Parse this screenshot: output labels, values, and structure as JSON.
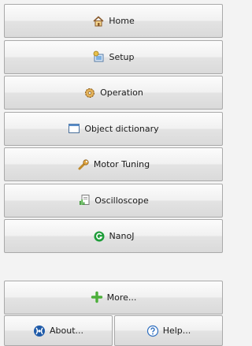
{
  "nav": {
    "home": {
      "label": "Home",
      "icon": "house-icon"
    },
    "setup": {
      "label": "Setup",
      "icon": "setup-wizard-icon"
    },
    "operation": {
      "label": "Operation",
      "icon": "gear-icon"
    },
    "object_dictionary": {
      "label": "Object dictionary",
      "icon": "window-icon"
    },
    "motor_tuning": {
      "label": "Motor Tuning",
      "icon": "wrench-icon"
    },
    "oscilloscope": {
      "label": "Oscilloscope",
      "icon": "chart-document-icon"
    },
    "nanoj": {
      "label": "NanoJ",
      "icon": "circle-g-icon"
    },
    "more": {
      "label": "More...",
      "icon": "plus-icon"
    }
  },
  "footer": {
    "about": {
      "label": "About...",
      "icon": "logo-icon"
    },
    "help": {
      "label": "Help...",
      "icon": "question-icon"
    }
  },
  "colors": {
    "button_top": "#fcfcfc",
    "button_bottom": "#dadada",
    "border": "#a9a9a9",
    "plus_green": "#4caf3a",
    "nanoj_green": "#1f9d3a",
    "about_blue": "#1e5aa8"
  }
}
